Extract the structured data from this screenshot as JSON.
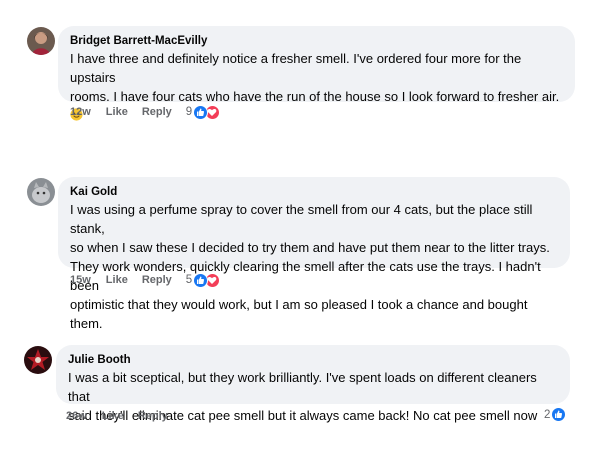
{
  "comments": [
    {
      "author": "Bridget Barrett-MacEvilly",
      "lines": [
        "I have three and definitely notice a fresher smell. I've ordered four more for the upstairs",
        "rooms. I have four cats who have the run of the house so I look forward to fresher air."
      ],
      "emoji": "smiling-face-emoji",
      "time": "12w",
      "like_label": "Like",
      "reply_label": "Reply",
      "reaction_count": "9",
      "reactions": [
        "like",
        "love"
      ]
    },
    {
      "author": "Kai Gold",
      "lines": [
        "I was using a perfume spray to cover the smell from our 4 cats, but the place still stank,",
        "so when I saw these I decided to try them and have put them near to the litter trays.",
        "They work wonders, quickly clearing the smell after the cats use the trays. I hadn't been",
        "optimistic that they would work, but I am so pleased I took a chance and bought them."
      ],
      "time": "15w",
      "like_label": "Like",
      "reply_label": "Reply",
      "reaction_count": "5",
      "reactions": [
        "like",
        "love"
      ]
    },
    {
      "author": "Julie Booth",
      "lines": [
        "I was a bit sceptical, but they work brilliantly. I've spent loads on different cleaners that",
        "said they'll eliminate cat pee smell but it always came back! No cat pee smell now"
      ],
      "time": "26w",
      "like_label": "Like",
      "reply_label": "Reply",
      "reaction_count": "2",
      "reactions": [
        "like"
      ]
    }
  ],
  "colors": {
    "bubble_bg": "#f0f2f5",
    "muted_text": "#65676b",
    "like_blue": "#1877f2",
    "love_red": "#f33e58"
  }
}
